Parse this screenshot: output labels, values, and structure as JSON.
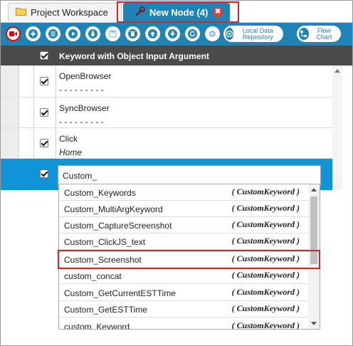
{
  "tabs": {
    "workspace_label": "Project Workspace",
    "node_label": "New Node (4)",
    "close_glyph": "✖"
  },
  "toolbar": {
    "buttons": [
      "record-icon",
      "add-icon",
      "list-icon",
      "play-icon",
      "debug-icon",
      "save-icon",
      "delete-icon",
      "move-up-icon",
      "move-down-icon",
      "refresh-icon",
      "settings-icon"
    ],
    "local_data_repository": "Local Data Repository",
    "flow_chart": "Flow Chart"
  },
  "grid": {
    "header": "Keyword with Object Input Argument",
    "rows": [
      {
        "keyword": "OpenBrowser",
        "argument": "- - - - - - - - -"
      },
      {
        "keyword": "SyncBrowser",
        "argument": "- - - - - - - - -"
      },
      {
        "keyword": "Click",
        "argument": "Home"
      }
    ],
    "edit_value": "Custom_"
  },
  "dropdown": {
    "items": [
      {
        "name": "Custom_Keywords",
        "type": "( CustomKeyword )"
      },
      {
        "name": "Custom_MultiArgKeyword",
        "type": "( CustomKeyword )"
      },
      {
        "name": "Custom_CaptureScreenshot",
        "type": "( CustomKeyword )"
      },
      {
        "name": "Custom_ClickJS_text",
        "type": "( CustomKeyword )"
      },
      {
        "name": "Custom_Screenshot",
        "type": "( CustomKeyword )"
      },
      {
        "name": "custom_concat",
        "type": "( CustomKeyword )"
      },
      {
        "name": "Custom_GetCurrentESTTime",
        "type": "( CustomKeyword )"
      },
      {
        "name": "Custom_GetESTTime",
        "type": "( CustomKeyword )"
      },
      {
        "name": "custom_Keyword",
        "type": "( CustomKeyword )"
      }
    ],
    "highlighted": "Custom_Screenshot"
  },
  "colors": {
    "accent": "#1f83b6",
    "selected_row": "#1193d7",
    "highlight_border": "#d8232a"
  }
}
